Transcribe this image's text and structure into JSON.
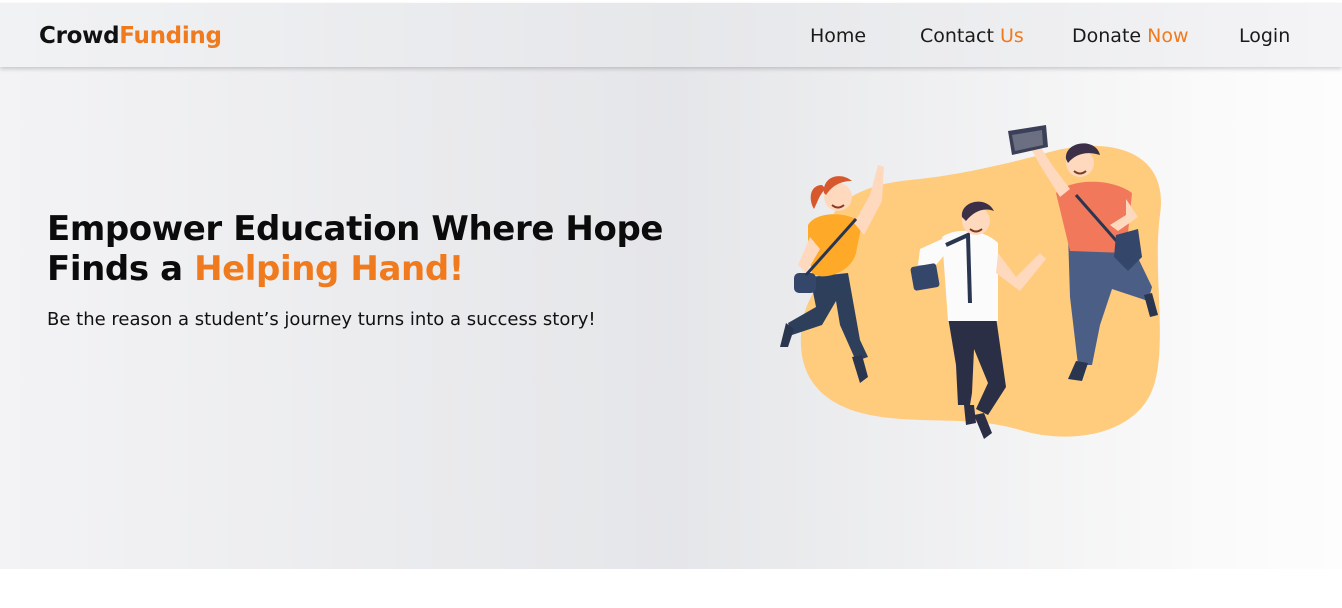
{
  "brand": {
    "part1": "Crowd",
    "part2": "Funding",
    "accent_color": "#f07a1e"
  },
  "nav": {
    "home": "Home",
    "contact": {
      "text": "Contact",
      "accent": "Us"
    },
    "donate": {
      "text": "Donate",
      "accent": "Now"
    },
    "login": "Login"
  },
  "hero": {
    "title_line1": "Empower Education Where Hope",
    "title_line2_plain": "Finds a",
    "title_line2_accent": "Helping Hand!",
    "subtitle": "Be the reason a student’s journey turns into a success story!"
  },
  "illustration": {
    "icon": "jumping-students-illustration",
    "blob_color": "#ffcb7d"
  }
}
